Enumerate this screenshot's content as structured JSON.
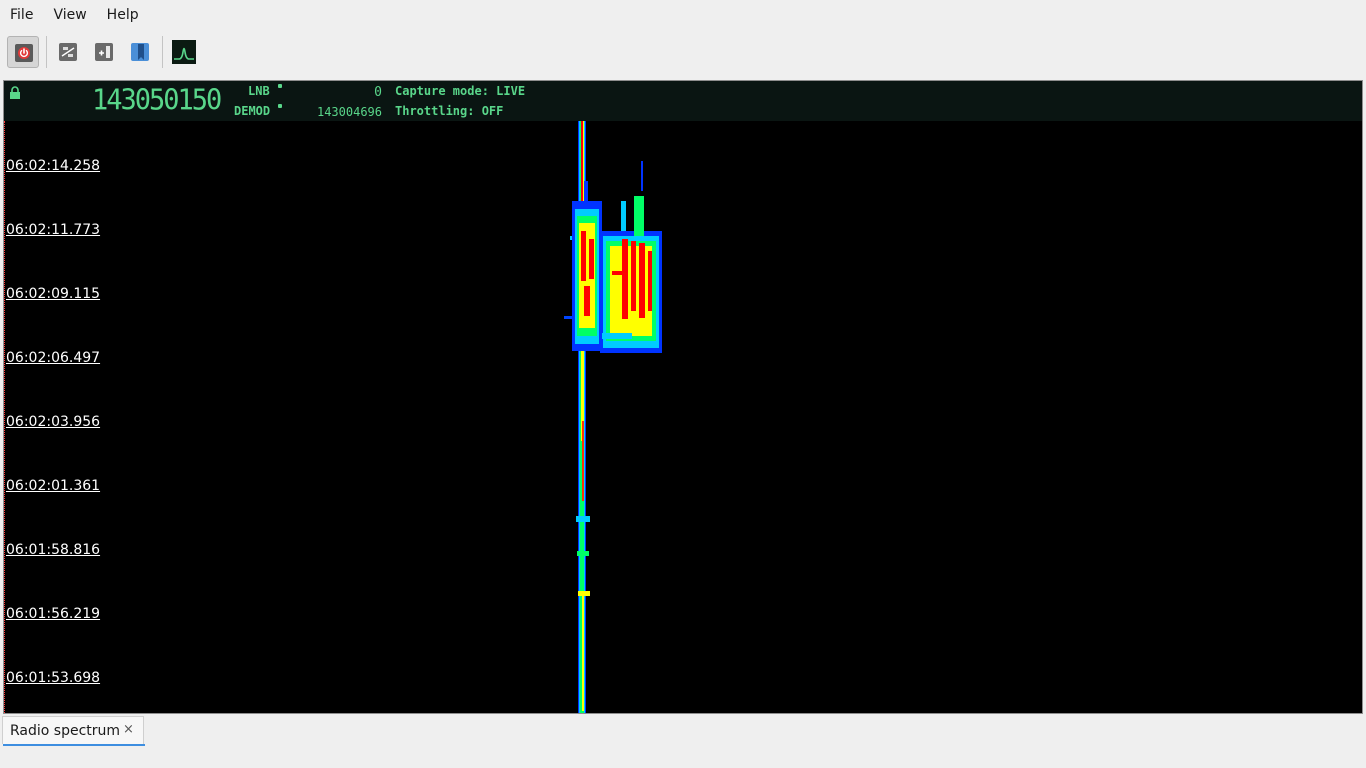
{
  "menubar": {
    "items": [
      {
        "label": "File"
      },
      {
        "label": "View"
      },
      {
        "label": "Help"
      }
    ]
  },
  "toolbar": {
    "buttons": [
      {
        "icon": "power-icon",
        "pressed": true
      },
      {
        "icon": "settings-sliders-icon"
      },
      {
        "icon": "add-panel-icon"
      },
      {
        "icon": "bookmark-icon"
      },
      {
        "icon": "spectrum-icon"
      }
    ]
  },
  "lcd": {
    "frequency": "143050150",
    "lnb_label": "LNB",
    "lnb_value": "0",
    "demod_label": "DEMOD",
    "demod_value": "143004696",
    "capture_mode": "Capture mode: LIVE",
    "throttling": "Throttling: OFF",
    "color": "#59d68a"
  },
  "waterfall": {
    "timestamps": [
      "06:02:14.258",
      "06:02:11.773",
      "06:02:09.115",
      "06:02:06.497",
      "06:02:03.956",
      "06:02:01.361",
      "06:01:58.816",
      "06:01:56.219",
      "06:01:53.698"
    ],
    "palette": [
      "#0000ff",
      "#00ccff",
      "#00ff66",
      "#ffff00",
      "#ff0000"
    ]
  },
  "tabs": [
    {
      "label": "Radio spectrum",
      "close": "×"
    }
  ]
}
